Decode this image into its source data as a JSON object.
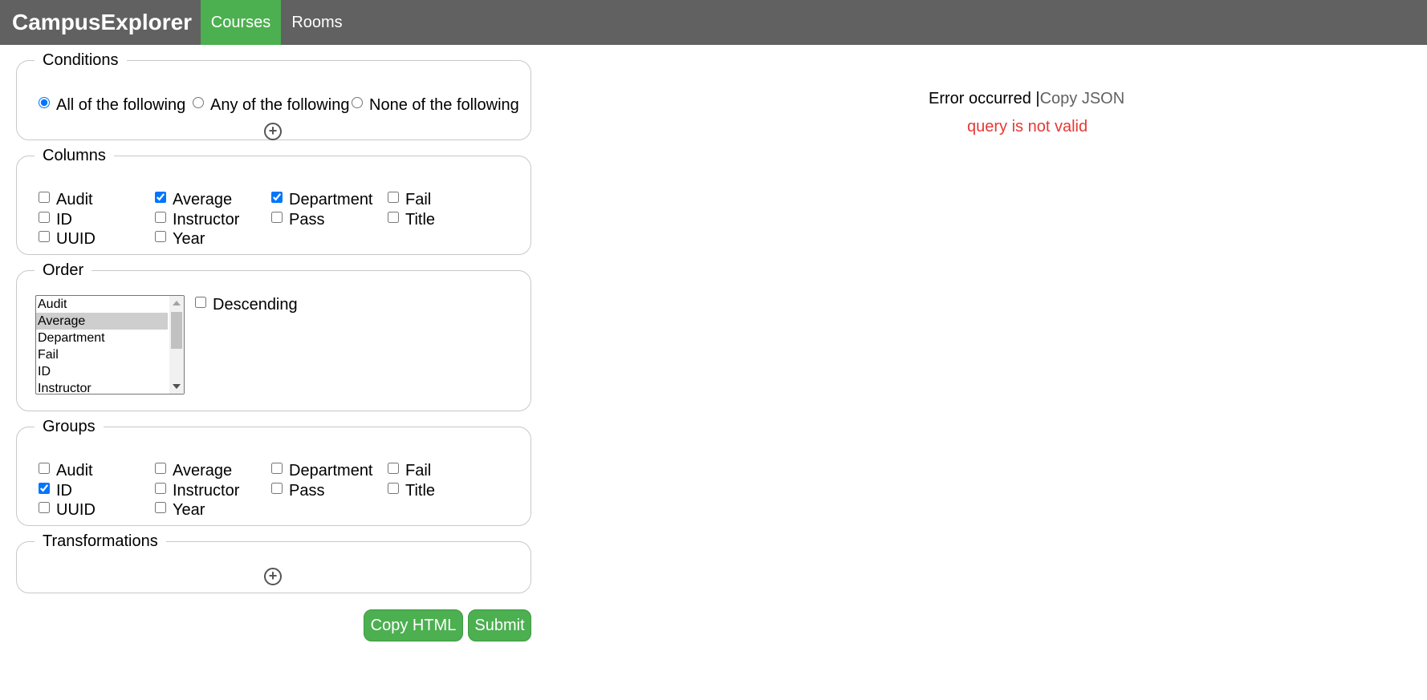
{
  "header": {
    "brand": "CampusExplorer",
    "tabs": [
      {
        "label": "Courses",
        "active": true
      },
      {
        "label": "Rooms",
        "active": false
      }
    ],
    "active_color": "#4caf50",
    "bar_color": "#616161"
  },
  "conditions": {
    "legend": "Conditions",
    "options": [
      {
        "label": "All of the following",
        "checked": true
      },
      {
        "label": "Any of the following",
        "checked": false
      },
      {
        "label": "None of the following",
        "checked": false
      }
    ],
    "add_icon": "plus-circle-icon"
  },
  "columns": {
    "legend": "Columns",
    "items": [
      {
        "label": "Audit",
        "checked": false
      },
      {
        "label": "Average",
        "checked": true
      },
      {
        "label": "Department",
        "checked": true
      },
      {
        "label": "Fail",
        "checked": false
      },
      {
        "label": "ID",
        "checked": false
      },
      {
        "label": "Instructor",
        "checked": false
      },
      {
        "label": "Pass",
        "checked": false
      },
      {
        "label": "Title",
        "checked": false
      },
      {
        "label": "UUID",
        "checked": false
      },
      {
        "label": "Year",
        "checked": false
      }
    ]
  },
  "order": {
    "legend": "Order",
    "options": [
      "Audit",
      "Average",
      "Department",
      "Fail",
      "ID",
      "Instructor"
    ],
    "selected": "Average",
    "descending_label": "Descending",
    "descending_checked": false
  },
  "groups": {
    "legend": "Groups",
    "items": [
      {
        "label": "Audit",
        "checked": false
      },
      {
        "label": "Average",
        "checked": false
      },
      {
        "label": "Department",
        "checked": false
      },
      {
        "label": "Fail",
        "checked": false
      },
      {
        "label": "ID",
        "checked": true
      },
      {
        "label": "Instructor",
        "checked": false
      },
      {
        "label": "Pass",
        "checked": false
      },
      {
        "label": "Title",
        "checked": false
      },
      {
        "label": "UUID",
        "checked": false
      },
      {
        "label": "Year",
        "checked": false
      }
    ]
  },
  "transformations": {
    "legend": "Transformations",
    "add_icon": "plus-circle-icon"
  },
  "buttons": {
    "copy_html": "Copy HTML",
    "submit": "Submit"
  },
  "result": {
    "status": "Error occurred",
    "separator": "|",
    "copy_json": "Copy JSON",
    "error": "query is not valid",
    "error_color": "#e53935"
  }
}
